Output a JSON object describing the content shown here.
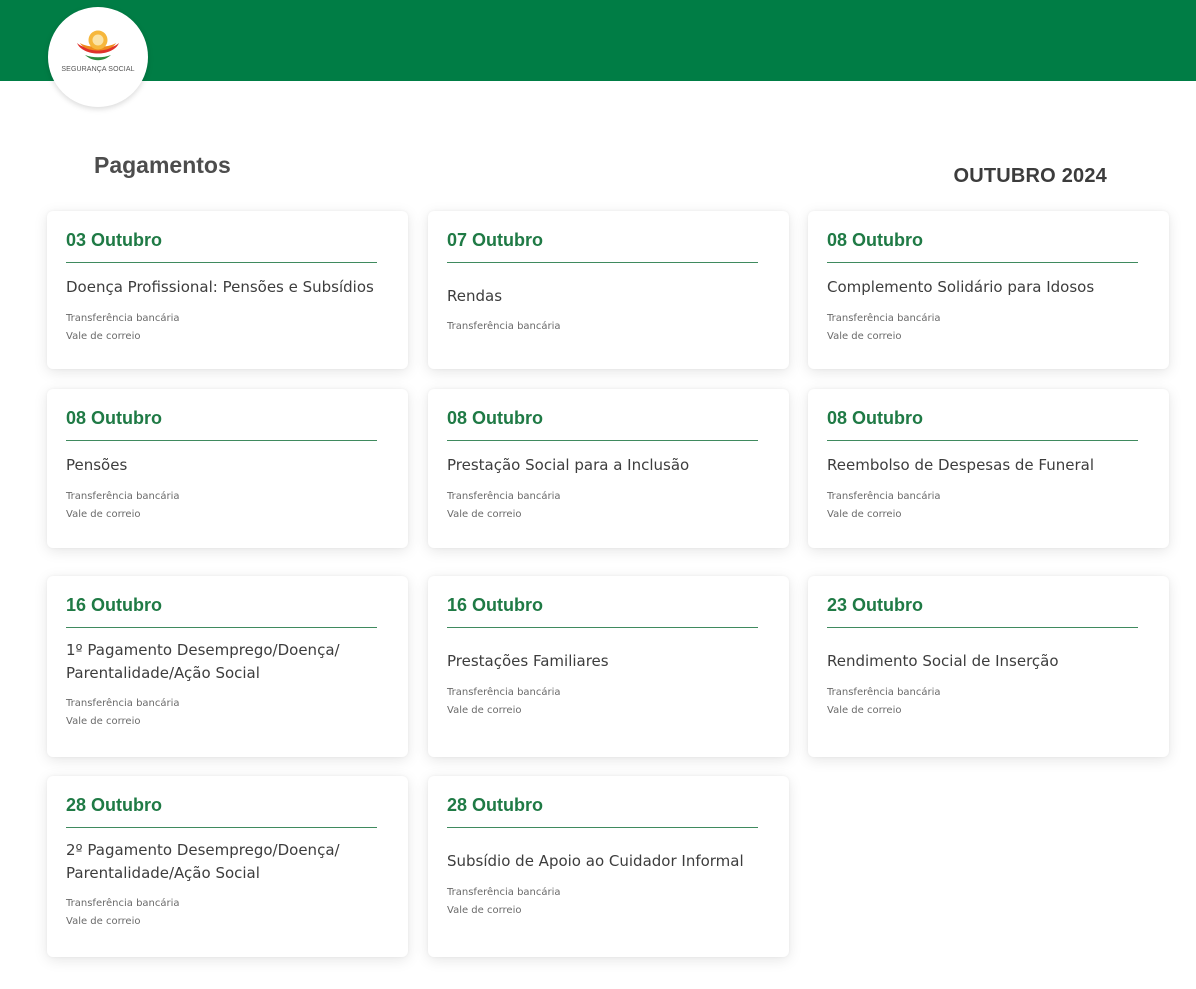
{
  "logo": {
    "text": "SEGURANÇA SOCIAL"
  },
  "header": {
    "title": "Pagamentos",
    "month": "OUTUBRO 2024",
    "bar_color": "#007d45",
    "accent_color": "#1f7a45"
  },
  "payments": [
    {
      "date": "03 Outubro",
      "title": "Doença Profissional: Pensões e Subsídios",
      "methods": [
        "Transferência bancária",
        "Vale de correio"
      ]
    },
    {
      "date": "07 Outubro",
      "title": "Rendas",
      "methods": [
        "Transferência bancária"
      ]
    },
    {
      "date": "08 Outubro",
      "title": "Complemento Solidário para Idosos",
      "methods": [
        "Transferência bancária",
        "Vale de correio"
      ]
    },
    {
      "date": "08 Outubro",
      "title": "Pensões",
      "methods": [
        "Transferência bancária",
        "Vale de correio"
      ]
    },
    {
      "date": "08 Outubro",
      "title": "Prestação Social para a Inclusão",
      "methods": [
        "Transferência bancária",
        "Vale de correio"
      ]
    },
    {
      "date": "08 Outubro",
      "title": "Reembolso de Despesas de Funeral",
      "methods": [
        "Transferência bancária",
        "Vale de correio"
      ]
    },
    {
      "date": "16 Outubro",
      "title": "1º Pagamento Desemprego/Doença/ Parentalidade/Ação Social",
      "methods": [
        "Transferência bancária",
        "Vale de correio"
      ]
    },
    {
      "date": "16 Outubro",
      "title": "Prestações Familiares",
      "methods": [
        "Transferência bancária",
        "Vale de correio"
      ]
    },
    {
      "date": "23 Outubro",
      "title": "Rendimento Social de Inserção",
      "methods": [
        "Transferência bancária",
        "Vale de correio"
      ]
    },
    {
      "date": "28 Outubro",
      "title": "2º Pagamento Desemprego/Doença/ Parentalidade/Ação Social",
      "methods": [
        "Transferência bancária",
        "Vale de correio"
      ]
    },
    {
      "date": "28 Outubro",
      "title": "Subsídio de Apoio ao Cuidador Informal",
      "methods": [
        "Transferência bancária",
        "Vale de correio"
      ]
    }
  ]
}
